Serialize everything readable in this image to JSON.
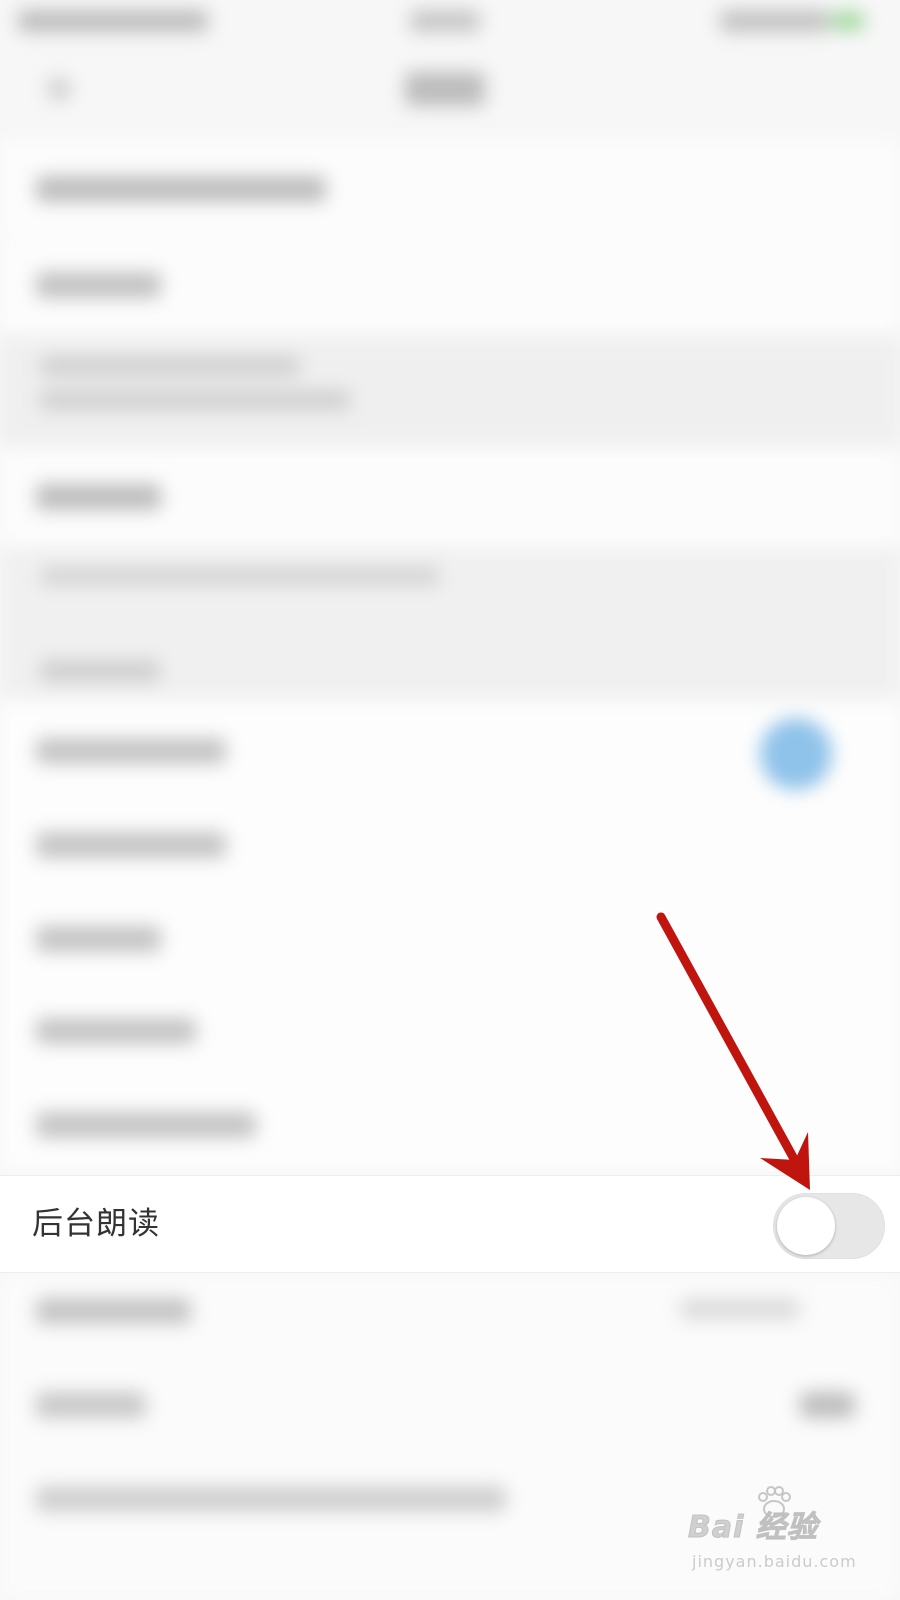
{
  "settings": {
    "background_reading": {
      "label": "后台朗读",
      "toggle_on": false
    }
  },
  "annotation": {
    "arrow_color": "#c0150f"
  },
  "watermark": {
    "brand": "Bai  经验",
    "url": "jingyan.baidu.com"
  },
  "colors": {
    "page_background": "#f7f7f7",
    "row_background": "#ffffff",
    "toggle_off_track": "#e7e7e7",
    "blurred_accent_blue": "#8fc3ea"
  }
}
